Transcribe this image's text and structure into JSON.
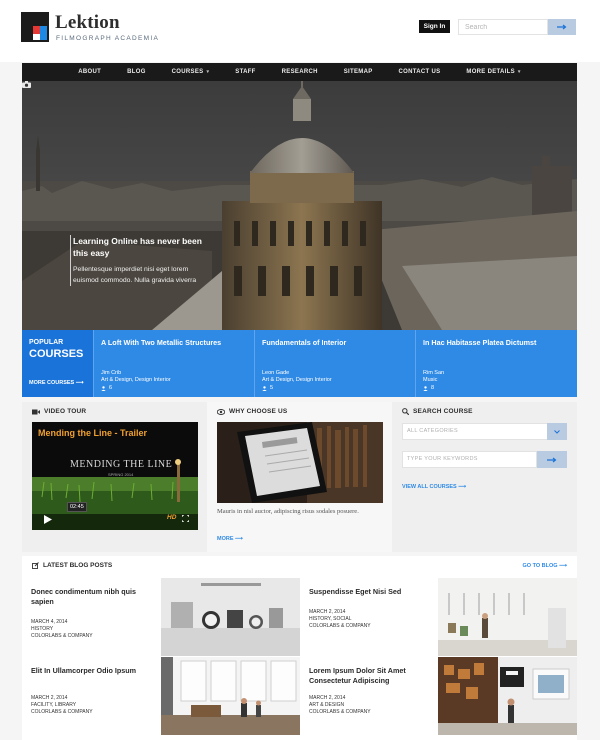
{
  "header": {
    "logo_title": "Lektion",
    "logo_subtitle": "FILMOGRAPH ACADEMIA",
    "signin_label": "Sign In",
    "search_placeholder": "Search"
  },
  "nav": {
    "items": [
      {
        "label": "ABOUT",
        "caret": false
      },
      {
        "label": "BLOG",
        "caret": false
      },
      {
        "label": "COURSES",
        "caret": true
      },
      {
        "label": "STAFF",
        "caret": false
      },
      {
        "label": "RESEARCH",
        "caret": false
      },
      {
        "label": "SITEMAP",
        "caret": false
      },
      {
        "label": "CONTACT US",
        "caret": false
      },
      {
        "label": "MORE DETAILS",
        "caret": true
      }
    ]
  },
  "hero": {
    "title": "Learning Online has never been this easy",
    "body": "Pellentesque imperdiet nisi eget lorem euismod commodo. Nulla gravida viverra"
  },
  "popular": {
    "label_top": "POPULAR",
    "label_main": "COURSES",
    "more": "MORE COURSES",
    "courses": [
      {
        "title": "A Loft With Two Metallic Structures",
        "teacher": "Jim Crib",
        "category": "Art & Design, Design Interior",
        "count": "6"
      },
      {
        "title": "Fundamentals of Interior",
        "teacher": "Leon Gade",
        "category": "Art & Design, Design Interior",
        "count": "5"
      },
      {
        "title": "In Hac Habitasse Platea Dictumst",
        "teacher": "Rim San",
        "category": "Music",
        "count": "8"
      }
    ]
  },
  "video_tour": {
    "heading": "VIDEO TOUR",
    "video_title": "Mending the Line - Trailer",
    "overlay_title": "MENDING THE LINE",
    "overlay_sub": "SPRING 2014",
    "time": "02:45",
    "hd": "HD"
  },
  "why_choose": {
    "heading": "WHY CHOOSE US",
    "text": "Mauris in nisl auctor, adipiscing risus sodales posuere.",
    "more": "MORE"
  },
  "search_course": {
    "heading": "SEARCH COURSE",
    "categories_placeholder": "ALL CATEGORIES",
    "keywords_placeholder": "TYPE YOUR KEYWORDS",
    "view_all": "VIEW ALL COURSES"
  },
  "blog": {
    "heading": "LATEST BLOG POSTS",
    "goto": "GO TO BLOG",
    "posts": [
      {
        "title": "Donec condimentum nibh quis sapien",
        "date": "MARCH 4, 2014",
        "category": "HISTORY",
        "author": "COLORLABS & COMPANY"
      },
      {
        "title": "Suspendisse Eget Nisi Sed",
        "date": "MARCH 2, 2014",
        "category": "HISTORY, SOCIAL",
        "author": "COLORLABS & COMPANY"
      },
      {
        "title": "Elit In Ullamcorper Odio Ipsum",
        "date": "MARCH 2, 2014",
        "category": "FACILITY, LIBRARY",
        "author": "COLORLABS & COMPANY"
      },
      {
        "title": "Lorem Ipsum Dolor Sit Amet Consectetur Adipiscing",
        "date": "MARCH 2, 2014",
        "category": "ART & DESIGN",
        "author": "COLORLABS & COMPANY"
      }
    ]
  },
  "colors": {
    "accent": "#2f8ae6",
    "accent_dark": "#1a73d9",
    "nav_bg": "#1a1a1a",
    "button_light": "#b9cbe0"
  }
}
